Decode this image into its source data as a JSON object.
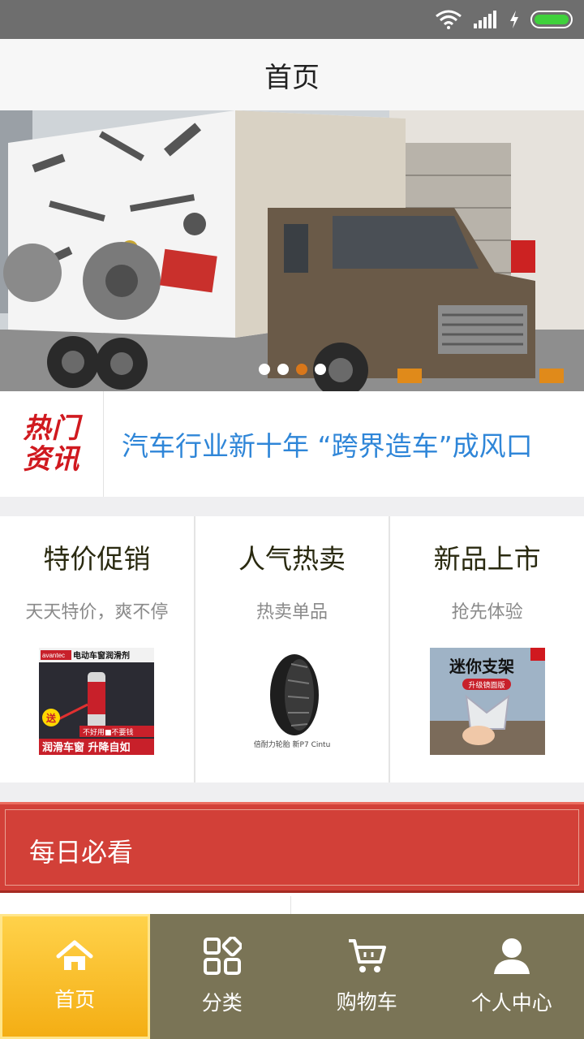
{
  "header": {
    "title": "首页"
  },
  "banner": {
    "slide_count": 4,
    "active_index": 2,
    "colors": {
      "dot": "#ffffff",
      "dot_active": "#d9771a"
    }
  },
  "hot_news": {
    "logo_line1": "热门",
    "logo_line2": "资讯",
    "headline": "汽车行业新十年 “跨界造车”成风口"
  },
  "promos": [
    {
      "title": "特价促销",
      "subtitle": "天天特价，爽不停",
      "image_icon": "lubricant-spray-product-image",
      "img_text_brand": "avantec",
      "img_text_top": "电动车窗润滑剂",
      "img_text_badge": "送",
      "img_text_strip": "不好用■不要钱",
      "img_text_bottom": "润滑车窗 升降自如"
    },
    {
      "title": "人气热卖",
      "subtitle": "热卖单品",
      "image_icon": "tire-product-image",
      "img_caption": "倍耐力轮胎 新P7 Cintu"
    },
    {
      "title": "新品上市",
      "subtitle": "抢先体验",
      "image_icon": "phone-holder-product-image",
      "img_text_top": "迷你支架",
      "img_text_strip": "升级镜面版"
    }
  ],
  "daily": {
    "label": "每日必看"
  },
  "bottom_nav": [
    {
      "label": "首页",
      "icon": "home-icon",
      "active": true
    },
    {
      "label": "分类",
      "icon": "category-icon",
      "active": false
    },
    {
      "label": "购物车",
      "icon": "cart-icon",
      "active": false
    },
    {
      "label": "个人中心",
      "icon": "user-icon",
      "active": false
    }
  ],
  "colors": {
    "accent_blue": "#2f86d8",
    "hot_red": "#d0191f",
    "daily_red": "#d24038",
    "nav_bg": "#7a7456",
    "nav_active": "#f4ae14"
  }
}
